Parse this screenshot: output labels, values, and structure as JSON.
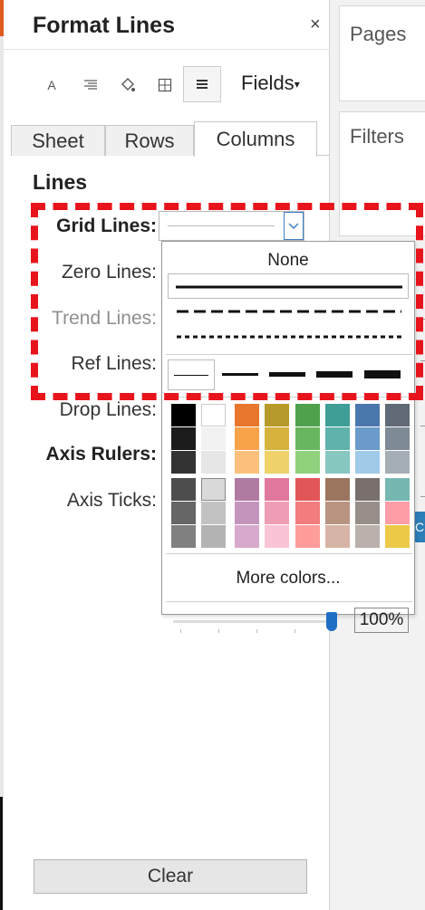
{
  "panel": {
    "title": "Format Lines",
    "close_glyph": "×",
    "toolbar": {
      "icons": [
        "font-icon",
        "alignment-icon",
        "shading-icon",
        "borders-icon",
        "lines-icon"
      ],
      "fields_label": "Fields",
      "fields_caret": "▾"
    },
    "tabs": [
      "Sheet",
      "Rows",
      "Columns"
    ],
    "active_tab": "Columns",
    "section_title": "Lines",
    "rows": [
      {
        "label": "Grid Lines:",
        "style": "bold"
      },
      {
        "label": "Zero Lines:",
        "style": "normal"
      },
      {
        "label": "Trend Lines:",
        "style": "muted"
      },
      {
        "label": "Ref Lines:",
        "style": "normal"
      },
      {
        "label": "Drop Lines:",
        "style": "normal"
      },
      {
        "label": "Axis Rulers:",
        "style": "bold"
      },
      {
        "label": "Axis Ticks:",
        "style": "normal"
      }
    ],
    "select_caret": "⌄",
    "clear_label": "Clear"
  },
  "dropdown": {
    "none_label": "None",
    "line_styles": [
      "solid",
      "dashed",
      "dotted"
    ],
    "selected_style": "solid",
    "widths": [
      "thinnest",
      "thin",
      "medium",
      "thick",
      "thickest"
    ],
    "selected_width": "thinnest",
    "swatch_columns": [
      [
        "#000000",
        "#1c1c1c",
        "#333333",
        "#4d4d4d",
        "#666666",
        "#808080"
      ],
      [
        "#ffffff",
        "#f2f2f2",
        "#e6e6e6",
        "#d9d9d9",
        "#c2c2c2",
        "#b3b3b3"
      ],
      [
        "#e8762d",
        "#f8a24a",
        "#fcc07c",
        "#b07aa1",
        "#c394bd",
        "#d7a9cc"
      ],
      [
        "#b79a29",
        "#d6b33c",
        "#f0d16a",
        "#e0779c",
        "#ef9db5",
        "#fac4d6"
      ],
      [
        "#4fa14c",
        "#68b65f",
        "#8fd17d",
        "#e15759",
        "#f27c7e",
        "#ff9d9a"
      ],
      [
        "#3f9e97",
        "#5fb3ac",
        "#86c7c0",
        "#9c755f",
        "#b99481",
        "#d7b5a6"
      ],
      [
        "#4a77ad",
        "#6a9bcb",
        "#a0cbe8",
        "#79706e",
        "#978e8a",
        "#bab0ac"
      ],
      [
        "#5f6a76",
        "#7e8a95",
        "#a5adb5",
        "#76b7b2",
        "#ff9da7",
        "#edc948"
      ]
    ],
    "selected_swatch": "#d9d9d9",
    "more_colors_label": "More colors...",
    "opacity_value": "100%",
    "opacity_fraction": 1.0
  },
  "sidebar": {
    "cards": [
      "Pages",
      "Filters"
    ],
    "fragment_glyph": "C"
  },
  "colors": {
    "highlight": "#e8141c",
    "accent": "#1f6fc5"
  }
}
